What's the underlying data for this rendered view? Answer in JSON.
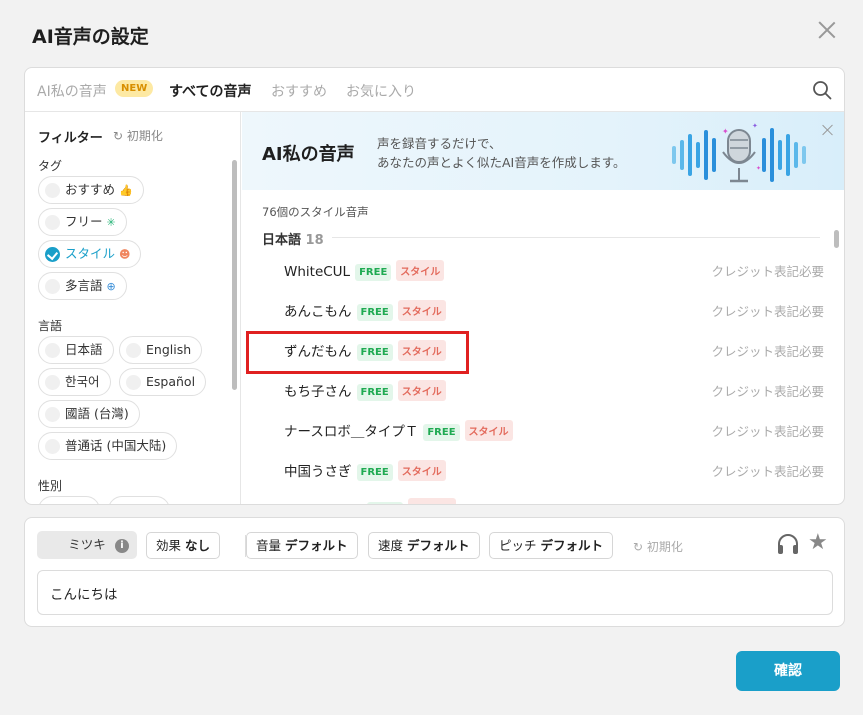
{
  "dialog": {
    "title": "AI音声の設定"
  },
  "tabs": [
    {
      "label": "AI私の音声",
      "badge": "NEW"
    },
    {
      "label": "すべての音声"
    },
    {
      "label": "おすすめ"
    },
    {
      "label": "お気に入り"
    }
  ],
  "sidebar": {
    "filter_title": "フィルター",
    "reset_label": "初期化",
    "tag_label": "タグ",
    "tags": [
      "おすすめ",
      "フリー",
      "スタイル",
      "多言語"
    ],
    "language_label": "言語",
    "languages": [
      "日本語",
      "English",
      "한국어",
      "Español",
      "國語 (台灣)",
      "普通话 (中国大陆)"
    ],
    "gender_label": "性別"
  },
  "banner": {
    "title": "AI私の音声",
    "desc_line1": "声を録音するだけで、",
    "desc_line2": "あなたの声とよく似たAI音声を作成します。"
  },
  "list": {
    "count_label": "76個のスタイル音声",
    "group_name": "日本語",
    "group_count": "18",
    "free_tag": "FREE",
    "style_tag": "スタイル",
    "credit_label": "クレジット表記必要",
    "voices": [
      "WhiteCUL",
      "あんこもん",
      "ずんだもん",
      "もち子さん",
      "ナースロボ＿タイプＴ",
      "中国うさぎ"
    ]
  },
  "controls": {
    "voice": "ミツキ",
    "info": "i",
    "effect_label": "効果",
    "effect_value": "なし",
    "volume_label": "音量",
    "volume_value": "デフォルト",
    "speed_label": "速度",
    "speed_value": "デフォルト",
    "pitch_label": "ピッチ",
    "pitch_value": "デフォルト",
    "reset_label": "初期化",
    "text_value": "こんにちは"
  },
  "confirm_label": "確認",
  "colors": {
    "accent": "#1a9fc9",
    "free": "#1faa52",
    "style": "#e36a5c",
    "highlight": "#e02020"
  }
}
